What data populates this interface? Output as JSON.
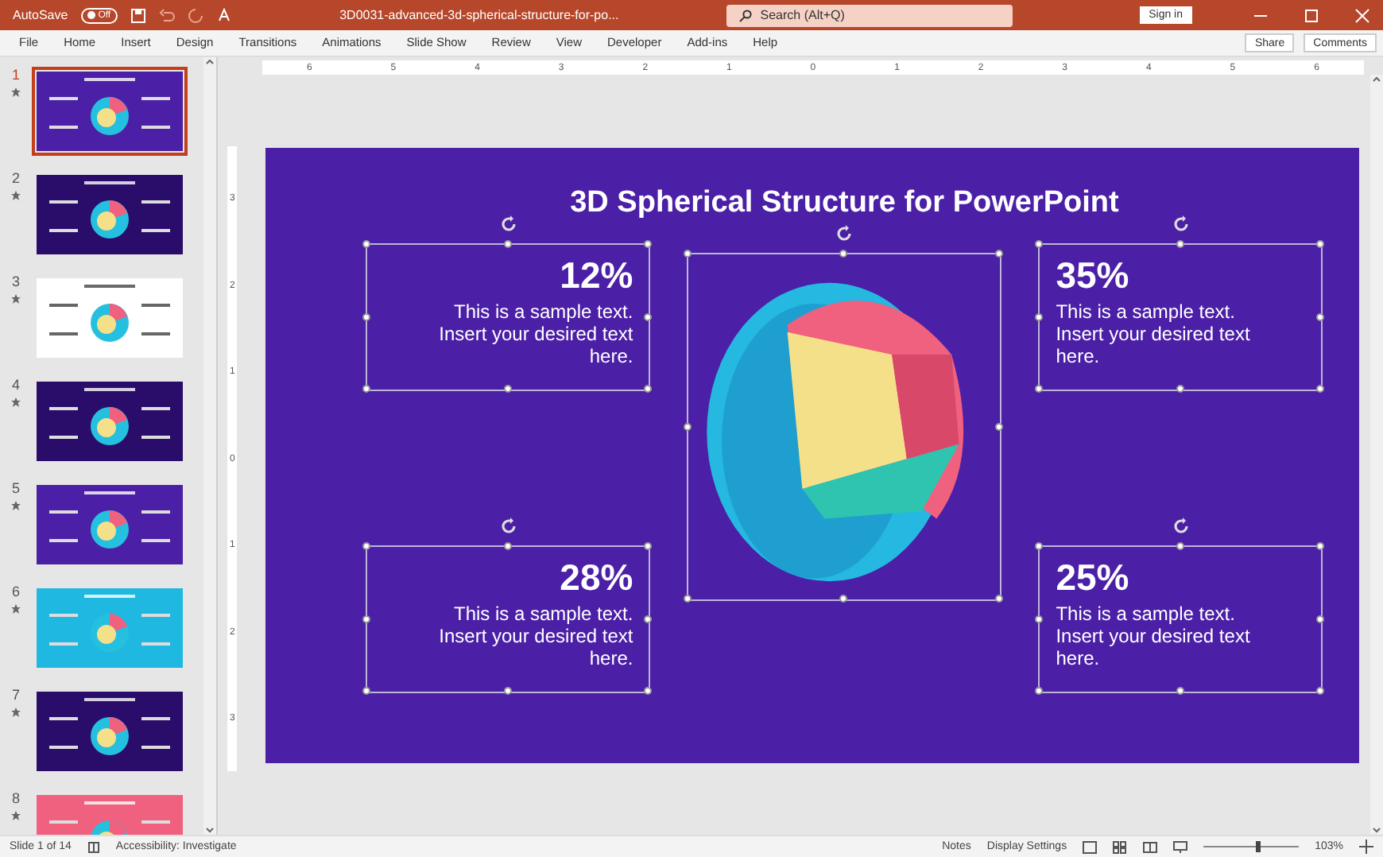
{
  "title_bar": {
    "autosave_label": "AutoSave",
    "autosave": {
      "on": false,
      "label": "Off"
    },
    "file_name": "3D0031-advanced-3d-spherical-structure-for-po...",
    "search": {
      "placeholder": "Search (Alt+Q)"
    },
    "sign_in": "Sign in"
  },
  "ribbon": {
    "tabs": [
      {
        "label": "File",
        "selected": false
      },
      {
        "label": "Home",
        "selected": false
      },
      {
        "label": "Insert",
        "selected": false
      },
      {
        "label": "Design",
        "selected": false
      },
      {
        "label": "Transitions",
        "selected": false
      },
      {
        "label": "Animations",
        "selected": false
      },
      {
        "label": "Slide Show",
        "selected": false
      },
      {
        "label": "Review",
        "selected": false
      },
      {
        "label": "View",
        "selected": false
      },
      {
        "label": "Developer",
        "selected": false
      },
      {
        "label": "Add-ins",
        "selected": false
      },
      {
        "label": "Help",
        "selected": false
      }
    ],
    "share": "Share",
    "comments": "Comments"
  },
  "thumbnails": [
    {
      "number": "1",
      "selected": true,
      "color": "#4b1fa6"
    },
    {
      "number": "2",
      "selected": false,
      "color": "#2a0d6b"
    },
    {
      "number": "3",
      "selected": false,
      "color": "#ffffff"
    },
    {
      "number": "4",
      "selected": false,
      "color": "#2a0d6b"
    },
    {
      "number": "5",
      "selected": false,
      "color": "#4b1fa6"
    },
    {
      "number": "6",
      "selected": false,
      "color": "#1fb8e0"
    },
    {
      "number": "7",
      "selected": false,
      "color": "#2a0d6b"
    },
    {
      "number": "8",
      "selected": false,
      "color": "#f0607f"
    }
  ],
  "ruler": {
    "horizontal": [
      "6",
      "5",
      "4",
      "3",
      "2",
      "1",
      "0",
      "1",
      "2",
      "3",
      "4",
      "5",
      "6"
    ],
    "vertical": [
      "3",
      "2",
      "1",
      "0",
      "1",
      "2",
      "3"
    ]
  },
  "slide": {
    "title": "3D Spherical Structure for PowerPoint",
    "items": [
      {
        "percent": "12%",
        "text": "This is a sample text. Insert your desired text here."
      },
      {
        "percent": "35%",
        "text": "This is a sample text. Insert your desired text here."
      },
      {
        "percent": "28%",
        "text": "This is a sample text. Insert your desired text here."
      },
      {
        "percent": "25%",
        "text": "This is a sample text. Insert your desired text here."
      }
    ]
  },
  "status_bar": {
    "slide_count": "Slide 1 of 14",
    "accessibility": "Accessibility: Investigate",
    "notes": "Notes",
    "display_settings": "Display Settings",
    "zoom": {
      "label": "103%",
      "level": 0.55
    }
  }
}
